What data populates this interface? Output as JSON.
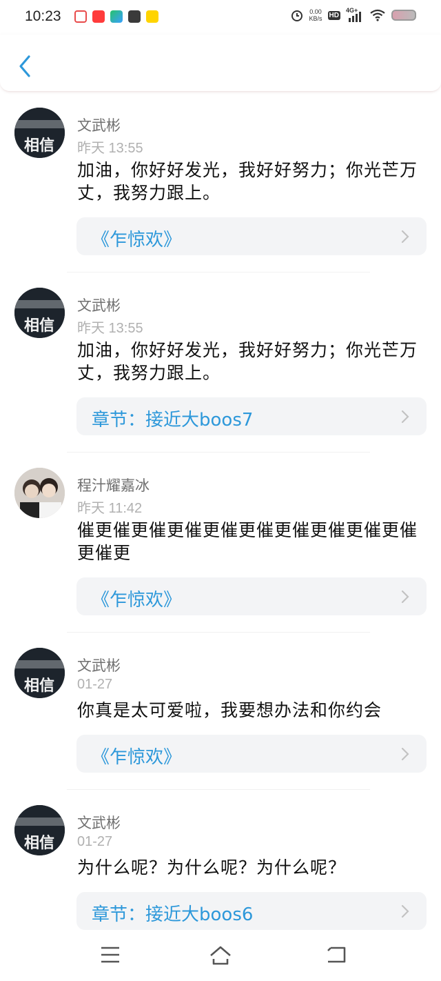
{
  "status_bar": {
    "time": "10:23",
    "net_speed_value": "0.00",
    "net_speed_unit": "KB/s",
    "hd_label": "HD",
    "network_label": "4G+",
    "app_icons": [
      {
        "name": "app-icon-1",
        "color": "#e84a4a"
      },
      {
        "name": "app-icon-2",
        "color": "#ff3b3b"
      },
      {
        "name": "app-icon-3",
        "color": "#27c26b"
      },
      {
        "name": "app-icon-4",
        "color": "#3a3a3a"
      },
      {
        "name": "app-icon-5",
        "color": "#ffd400"
      }
    ]
  },
  "header": {
    "back_icon": "chevron-left-icon"
  },
  "avatar_text": "相信",
  "comments": [
    {
      "name": "文武彬",
      "time": "昨天 13:55",
      "text": "加油，你好好发光，我好好努力；你光芒万丈，我努力跟上。",
      "link": "《乍惊欢》",
      "avatar": "xiangxin"
    },
    {
      "name": "文武彬",
      "time": "昨天 13:55",
      "text": "加油，你好好发光，我好好努力；你光芒万丈，我努力跟上。",
      "link": "章节：接近大boos7",
      "avatar": "xiangxin"
    },
    {
      "name": "程汁耀嘉冰",
      "time": "昨天 11:42",
      "text": "催更催更催更催更催更催更催更催更催更催更催更",
      "link": "《乍惊欢》",
      "avatar": "photo"
    },
    {
      "name": "文武彬",
      "time": "01-27",
      "text": "你真是太可爱啦，我要想办法和你约会",
      "link": "《乍惊欢》",
      "avatar": "xiangxin"
    },
    {
      "name": "文武彬",
      "time": "01-27",
      "text": "为什么呢？为什么呢？为什么呢？",
      "link": "章节：接近大boos6",
      "avatar": "xiangxin"
    }
  ],
  "colors": {
    "accent": "#2d98da",
    "name": "#6f6f6f",
    "time": "#b0b0b0",
    "card_bg": "#f3f4f6"
  }
}
